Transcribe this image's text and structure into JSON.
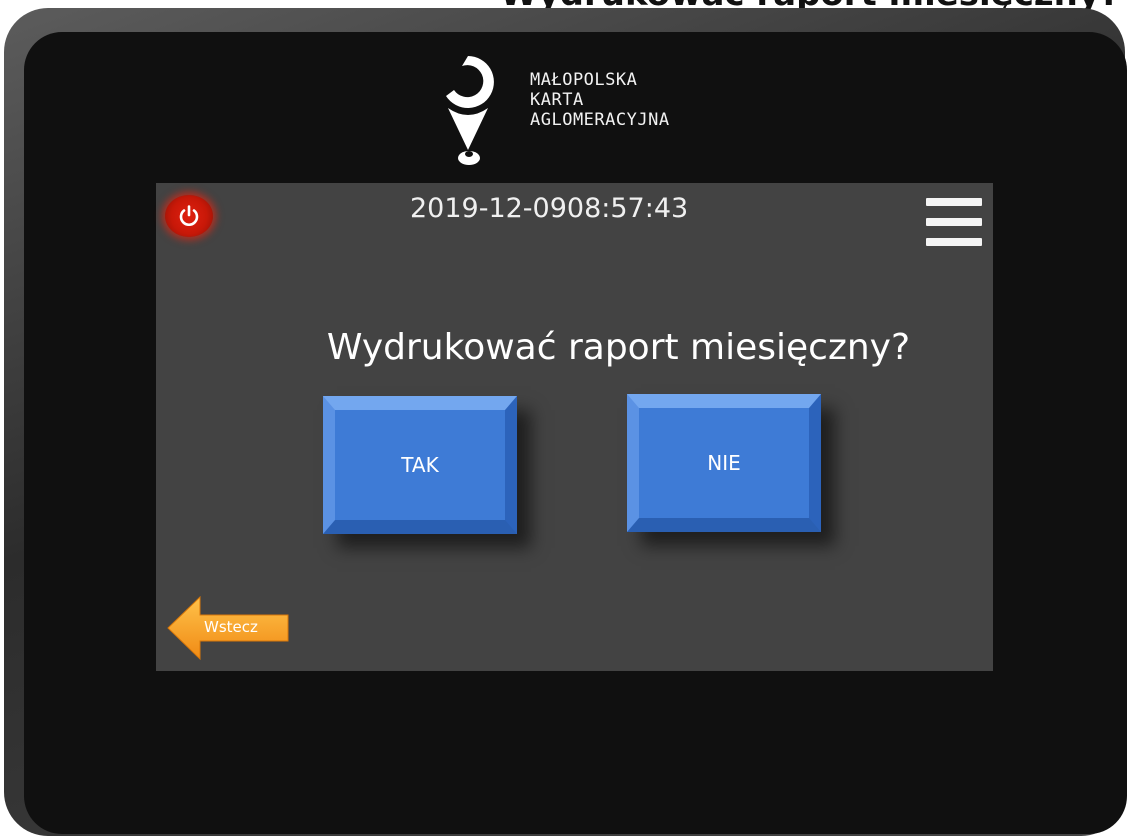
{
  "page_heading": "Wydrukować raport miesięczny?",
  "brand": {
    "lines": [
      "MAŁOPOLSKA",
      "KARTA",
      "AGLOMERACYJNA"
    ]
  },
  "status_bar": {
    "date": "2019-12-09",
    "time": "08:57:43",
    "power_icon": "power-icon",
    "menu_icon": "hamburger-menu-icon"
  },
  "dialog": {
    "question": "Wydrukować raport miesięczny?",
    "yes_label": "TAK",
    "no_label": "NIE"
  },
  "navigation": {
    "back_label": "Wstecz",
    "back_icon": "arrow-left-icon"
  },
  "colors": {
    "screen_bg": "#434343",
    "button_blue": "#3e7bd6",
    "power_red": "#d01a0a",
    "back_orange": "#f7a12a"
  }
}
